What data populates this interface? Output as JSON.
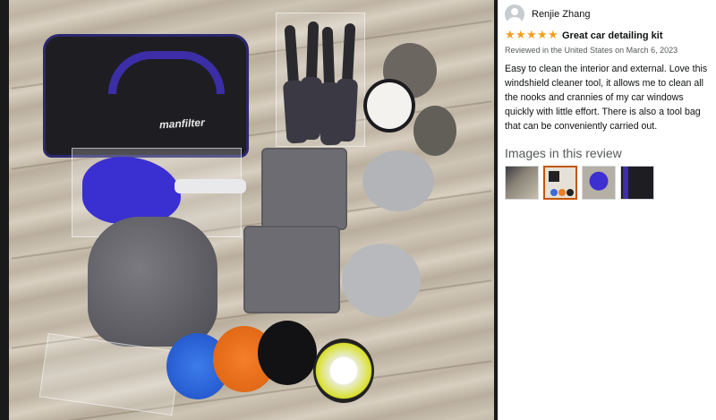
{
  "photo": {
    "bag_logo": "manfilter"
  },
  "review": {
    "reviewer_name": "Renjie Zhang",
    "rating": 5,
    "rating_max": 5,
    "title": "Great car detailing kit",
    "date_line": "Reviewed in the United States on March 6, 2023",
    "body": "Easy to clean the interior and external. Love this windshield cleaner tool, it allows me to clean all the nooks and crannies of my car windows quickly with little effort. There is also a tool bag that can be conveniently carried out.",
    "images_heading": "Images in this review",
    "thumbnail_count": 4
  },
  "colors": {
    "star": "#f79c1c",
    "text": "#0f1111",
    "secondary_text": "#565959",
    "selected_thumb_border": "#c45500"
  },
  "icons": {
    "avatar": "default-user-avatar-icon",
    "star": "star-icon"
  }
}
